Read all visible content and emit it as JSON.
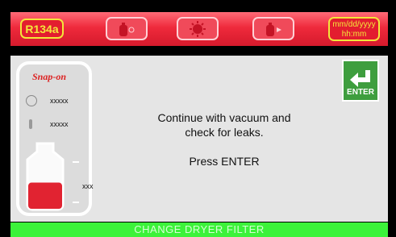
{
  "topbar": {
    "refrigerant_label": "R134a",
    "datetime_line1": "mm/dd/yyyy",
    "datetime_line2": "hh:mm",
    "icons": [
      "recover-tank-icon",
      "vacuum-pump-icon",
      "charge-tank-icon"
    ]
  },
  "panel": {
    "logo": "Snap-on",
    "pressure_value": "xxxxx",
    "temperature_value": "xxxxx",
    "tank_value": "xxx",
    "tank_fill_fraction": 0.55
  },
  "message": {
    "line1": "Continue with vacuum and",
    "line2": "check for leaks.",
    "prompt": "Press ENTER"
  },
  "enter_button": {
    "label": "ENTER"
  },
  "status": {
    "text": "CHANGE DRYER FILTER"
  },
  "colors": {
    "topbar": "#ef2a3c",
    "accent": "#f3e63a",
    "status_bar": "#3cf23a",
    "enter_button": "#3e9e3e",
    "tank_fill": "#e12331"
  }
}
